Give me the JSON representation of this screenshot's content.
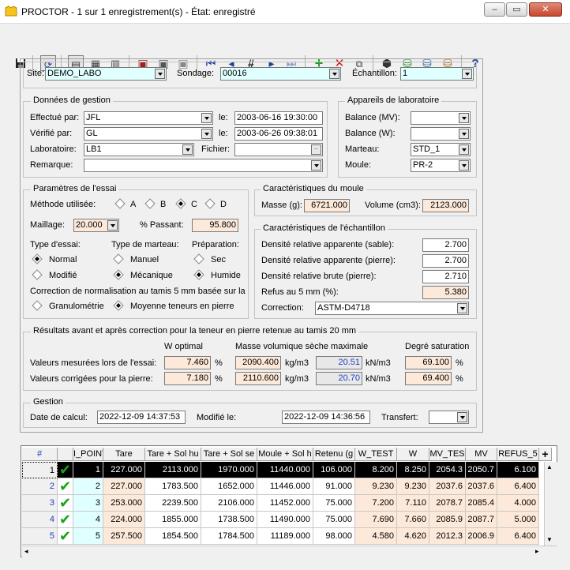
{
  "window": {
    "title": "PROCTOR - 1 sur 1 enregistrement(s) - État: enregistré"
  },
  "toolbar": {
    "icons": [
      "save-icon",
      "refresh-icon",
      "form-view-icon",
      "table-view-icon",
      "split-view-icon",
      "report-icon",
      "report-multi-icon",
      "report-grey-icon",
      "first-record-icon",
      "previous-record-icon",
      "goto-record-icon",
      "next-record-icon",
      "last-record-icon",
      "add-record-icon",
      "delete-record-icon",
      "copy-record-icon",
      "module-icon",
      "database-1-icon",
      "database-2-icon",
      "database-3-icon",
      "help-icon"
    ],
    "goto_glyph": "#",
    "help_glyph": "?"
  },
  "selection": {
    "site_label": "Site:",
    "site_value": "DEMO_LABO",
    "sondage_label": "Sondage:",
    "sondage_value": "00016",
    "echantillon_label": "Échantillon:",
    "echantillon_value": "1"
  },
  "gestion_donnees": {
    "legend": "Données de gestion",
    "effectue_label": "Effectué par:",
    "effectue_value": "JFL",
    "effectue_le_label": "le:",
    "effectue_le_value": "2003-06-16 19:30:00",
    "verifie_label": "Vérifié par:",
    "verifie_value": "GL",
    "verifie_le_label": "le:",
    "verifie_le_value": "2003-06-26 09:38:01",
    "laboratoire_label": "Laboratoire:",
    "laboratoire_value": "LB1",
    "fichier_label": "Fichier:",
    "fichier_value": "",
    "remarque_label": "Remarque:",
    "remarque_value": ""
  },
  "appareils": {
    "legend": "Appareils de laboratoire",
    "balance_mv_label": "Balance (MV):",
    "balance_mv_value": "",
    "balance_w_label": "Balance (W):",
    "balance_w_value": "",
    "marteau_label": "Marteau:",
    "marteau_value": "STD_1",
    "moule_label": "Moule:",
    "moule_value": "PR-2"
  },
  "parametres": {
    "legend": "Paramètres de l'essai",
    "methode_label": "Méthode utilisée:",
    "methodes": [
      "A",
      "B",
      "C",
      "D"
    ],
    "methode_selected": "C",
    "maillage_label": "Maillage:",
    "maillage_value": "20.000",
    "passant_label": "% Passant:",
    "passant_value": "95.800",
    "type_essai_label": "Type d'essai:",
    "type_essai_normal": "Normal",
    "type_essai_modifie": "Modifié",
    "type_marteau_label": "Type de marteau:",
    "marteau_manuel": "Manuel",
    "marteau_mecanique": "Mécanique",
    "preparation_label": "Préparation:",
    "prep_sec": "Sec",
    "prep_humide": "Humide",
    "correction_label": "Correction de normalisation au tamis 5 mm basée sur la",
    "corr_granulometrie": "Granulométrie",
    "corr_moyenne": "Moyenne teneurs en pierre"
  },
  "moule": {
    "legend": "Caractéristiques du moule",
    "masse_label": "Masse (g):",
    "masse_value": "6721.000",
    "volume_label": "Volume (cm3):",
    "volume_value": "2123.000"
  },
  "echantillon": {
    "legend": "Caractéristiques de l'échantillon",
    "dens_sable_label": "Densité relative apparente (sable):",
    "dens_sable_value": "2.700",
    "dens_pierre_label": "Densité relative apparente (pierre):",
    "dens_pierre_value": "2.700",
    "dens_brute_label": "Densité relative brute (pierre):",
    "dens_brute_value": "2.710",
    "refus_label": "Refus au 5 mm (%):",
    "refus_value": "5.380",
    "correction_label": "Correction:",
    "correction_value": "ASTM-D4718"
  },
  "resultats": {
    "legend": "Résultats avant et après correction pour la teneur en pierre retenue au tamis 20 mm",
    "col_w": "W optimal",
    "col_masse": "Masse volumique sèche maximale",
    "col_degre": "Degré saturation",
    "row1_label": "Valeurs mesurées lors de l'essai:",
    "row2_label": "Valeurs corrigées pour la pierre:",
    "unit_pct": "%",
    "unit_kgm3": "kg/m3",
    "unit_knm3": "kN/m3",
    "r1_w": "7.460",
    "r1_masse": "2090.400",
    "r1_kn": "20.51",
    "r1_degre": "69.100",
    "r2_w": "7.180",
    "r2_masse": "2110.600",
    "r2_kn": "20.70",
    "r2_degre": "69.400"
  },
  "gestion": {
    "legend": "Gestion",
    "date_calcul_label": "Date de calcul:",
    "date_calcul_value": "2022-12-09 14:37:53",
    "modifie_label": "Modifié le:",
    "modifie_value": "2022-12-09 14:36:56",
    "transfert_label": "Transfert:",
    "transfert_value": ""
  },
  "grid": {
    "headers": [
      "#",
      "",
      "I_POINT",
      "Tare",
      "Tare + Sol hu",
      "Tare + Sol se",
      "Moule + Sol h",
      "Retenu (g",
      "W_TEST",
      "W",
      "MV_TES",
      "MV",
      "REFUS_5",
      "+"
    ],
    "rows": [
      [
        "1",
        "✔",
        "1",
        "227.000",
        "2113.000",
        "1970.000",
        "11440.000",
        "106.000",
        "8.200",
        "8.250",
        "2054.3",
        "2050.7",
        "6.100"
      ],
      [
        "2",
        "✔",
        "2",
        "227.000",
        "1783.500",
        "1652.000",
        "11446.000",
        "91.000",
        "9.230",
        "9.230",
        "2037.6",
        "2037.6",
        "6.400"
      ],
      [
        "3",
        "✔",
        "3",
        "253.000",
        "2239.500",
        "2106.000",
        "11452.000",
        "75.000",
        "7.200",
        "7.110",
        "2078.7",
        "2085.4",
        "4.000"
      ],
      [
        "4",
        "✔",
        "4",
        "224.000",
        "1855.000",
        "1738.500",
        "11490.000",
        "75.000",
        "7.690",
        "7.660",
        "2085.9",
        "2087.7",
        "5.000"
      ],
      [
        "5",
        "✔",
        "5",
        "257.500",
        "1854.500",
        "1784.500",
        "11189.000",
        "98.000",
        "4.580",
        "4.620",
        "2012.3",
        "2006.9",
        "6.400"
      ]
    ]
  }
}
